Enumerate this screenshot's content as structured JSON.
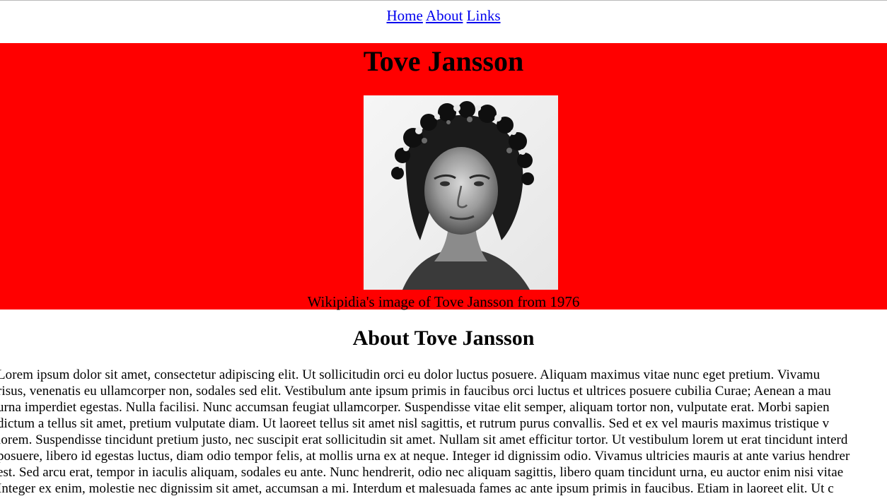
{
  "nav": {
    "links": [
      "Home",
      "About",
      "Links"
    ]
  },
  "hero": {
    "title": "Tove Jansson",
    "image_alt": "Portrait of Tove Jansson wearing a flower crown",
    "caption": "Wikipidia's image of Tove Jansson from 1976",
    "background_color": "#ff0000"
  },
  "about": {
    "heading": "About Tove Jansson",
    "lines": [
      "Lorem ipsum dolor sit amet, consectetur adipiscing elit. Ut sollicitudin orci eu dolor luctus posuere. Aliquam maximus vitae nunc eget pretium. Vivamu",
      "risus, venenatis eu ullamcorper non, sodales sed elit. Vestibulum ante ipsum primis in faucibus orci luctus et ultrices posuere cubilia Curae; Aenean a mau",
      "urna imperdiet egestas. Nulla facilisi. Nunc accumsan feugiat ullamcorper. Suspendisse vitae elit semper, aliquam tortor non, vulputate erat. Morbi sapien",
      "dictum a tellus sit amet, pretium vulputate diam. Ut laoreet tellus sit amet nisl sagittis, et rutrum purus convallis. Sed et ex vel mauris maximus tristique v",
      "lorem. Suspendisse tincidunt pretium justo, nec suscipit erat sollicitudin sit amet. Nullam sit amet efficitur tortor. Ut vestibulum lorem ut erat tincidunt interd",
      "posuere, libero id egestas luctus, diam odio tempor felis, at mollis urna ex at neque. Integer id dignissim odio. Vivamus ultricies mauris at ante varius hendrer",
      "est. Sed arcu erat, tempor in iaculis aliquam, sodales eu ante. Nunc hendrerit, odio nec aliquam sagittis, libero quam tincidunt urna, eu auctor enim nisi vitae",
      "Integer ex enim, molestie nec dignissim sit amet, accumsan a mi. Interdum et malesuada fames ac ante ipsum primis in faucibus. Etiam in laoreet elit. Ut c"
    ]
  }
}
